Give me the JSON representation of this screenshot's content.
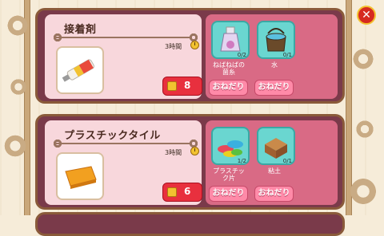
{
  "close_button": {
    "label": "✕"
  },
  "recipes": [
    {
      "name": "接着剤",
      "time": "3時間",
      "cost": "8",
      "product_icon": "glue-tube-icon",
      "materials": [
        {
          "name": "ねばねばの\n菌糸",
          "count": "0/2",
          "icon": "potion-bottle-icon",
          "button": "おねだり"
        },
        {
          "name": "水",
          "count": "0/1",
          "icon": "water-pot-icon",
          "button": "おねだり"
        }
      ]
    },
    {
      "name": "プラスチックタイル",
      "time": "3時間",
      "cost": "6",
      "product_icon": "orange-tile-icon",
      "materials": [
        {
          "name": "プラスチッ\nク片",
          "count": "1/2",
          "icon": "plastic-pieces-icon",
          "button": "おねだり"
        },
        {
          "name": "粘土",
          "count": "0/1",
          "icon": "clay-block-icon",
          "button": "おねだり"
        }
      ]
    }
  ],
  "colors": {
    "card_bg": "#7a3a4a",
    "left_panel": "#f8d7dc",
    "right_panel": "#d96a85",
    "slot": "#6ad6d0",
    "cost_button": "#e8303e",
    "beg_button": "#ff8aa8"
  }
}
